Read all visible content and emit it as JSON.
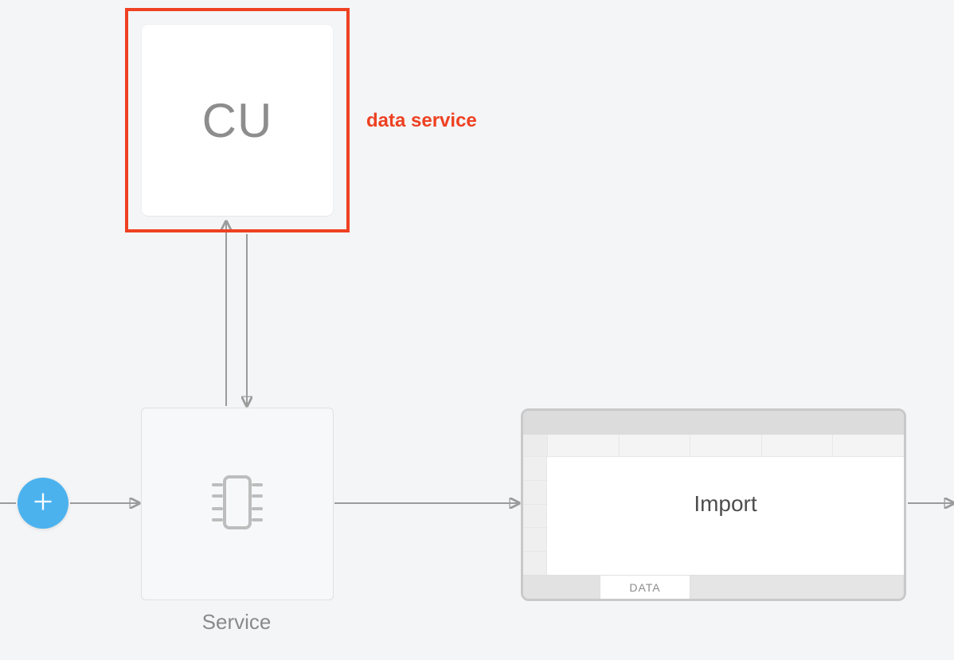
{
  "nodes": {
    "cu": {
      "icon_text": "CU",
      "label": "data service",
      "selected": true
    },
    "service": {
      "caption": "Service"
    },
    "import": {
      "title": "Import",
      "tab_label": "DATA"
    }
  },
  "add_button": {
    "icon": "plus-icon"
  },
  "colors": {
    "selection": "#ee4122",
    "accent_add": "#4bb2ee",
    "canvas_bg": "#f4f5f7"
  }
}
